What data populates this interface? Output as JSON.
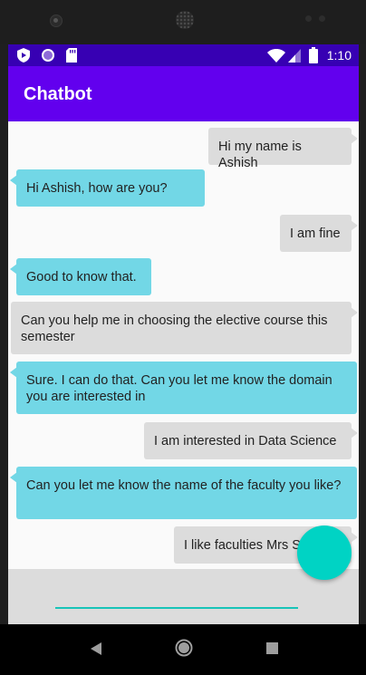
{
  "status_bar": {
    "time": "1:10",
    "icons": [
      "shield-icon",
      "circle-icon",
      "sd-card-icon",
      "wifi-icon",
      "signal-icon",
      "battery-icon"
    ]
  },
  "app_bar": {
    "title": "Chatbot"
  },
  "messages": [
    {
      "sender": "user",
      "text": "Hi my name is Ashish"
    },
    {
      "sender": "bot",
      "text": "Hi Ashish, how are you?"
    },
    {
      "sender": "user",
      "text": "I am fine"
    },
    {
      "sender": "bot",
      "text": "Good to know that."
    },
    {
      "sender": "user",
      "text": "Can you help me in choosing the elective course this semester"
    },
    {
      "sender": "bot",
      "text": "Sure. I can do that. Can you let me know the domain you are interested in"
    },
    {
      "sender": "user",
      "text": "I am interested in Data Science"
    },
    {
      "sender": "bot",
      "text": "Can you let me know the name of the faculty you like?"
    },
    {
      "sender": "user",
      "text": "I like faculties Mrs Shweta"
    }
  ],
  "input": {
    "value": "",
    "placeholder": ""
  },
  "navigation": {
    "buttons": [
      "back-icon",
      "home-icon",
      "recents-icon"
    ]
  },
  "colors": {
    "status_bar": "#3700b3",
    "app_bar": "#6200ee",
    "user_bubble": "#dcdcdc",
    "bot_bubble": "#72d7e6",
    "fab": "#00d3c4",
    "input_underline": "#18c4b8"
  }
}
